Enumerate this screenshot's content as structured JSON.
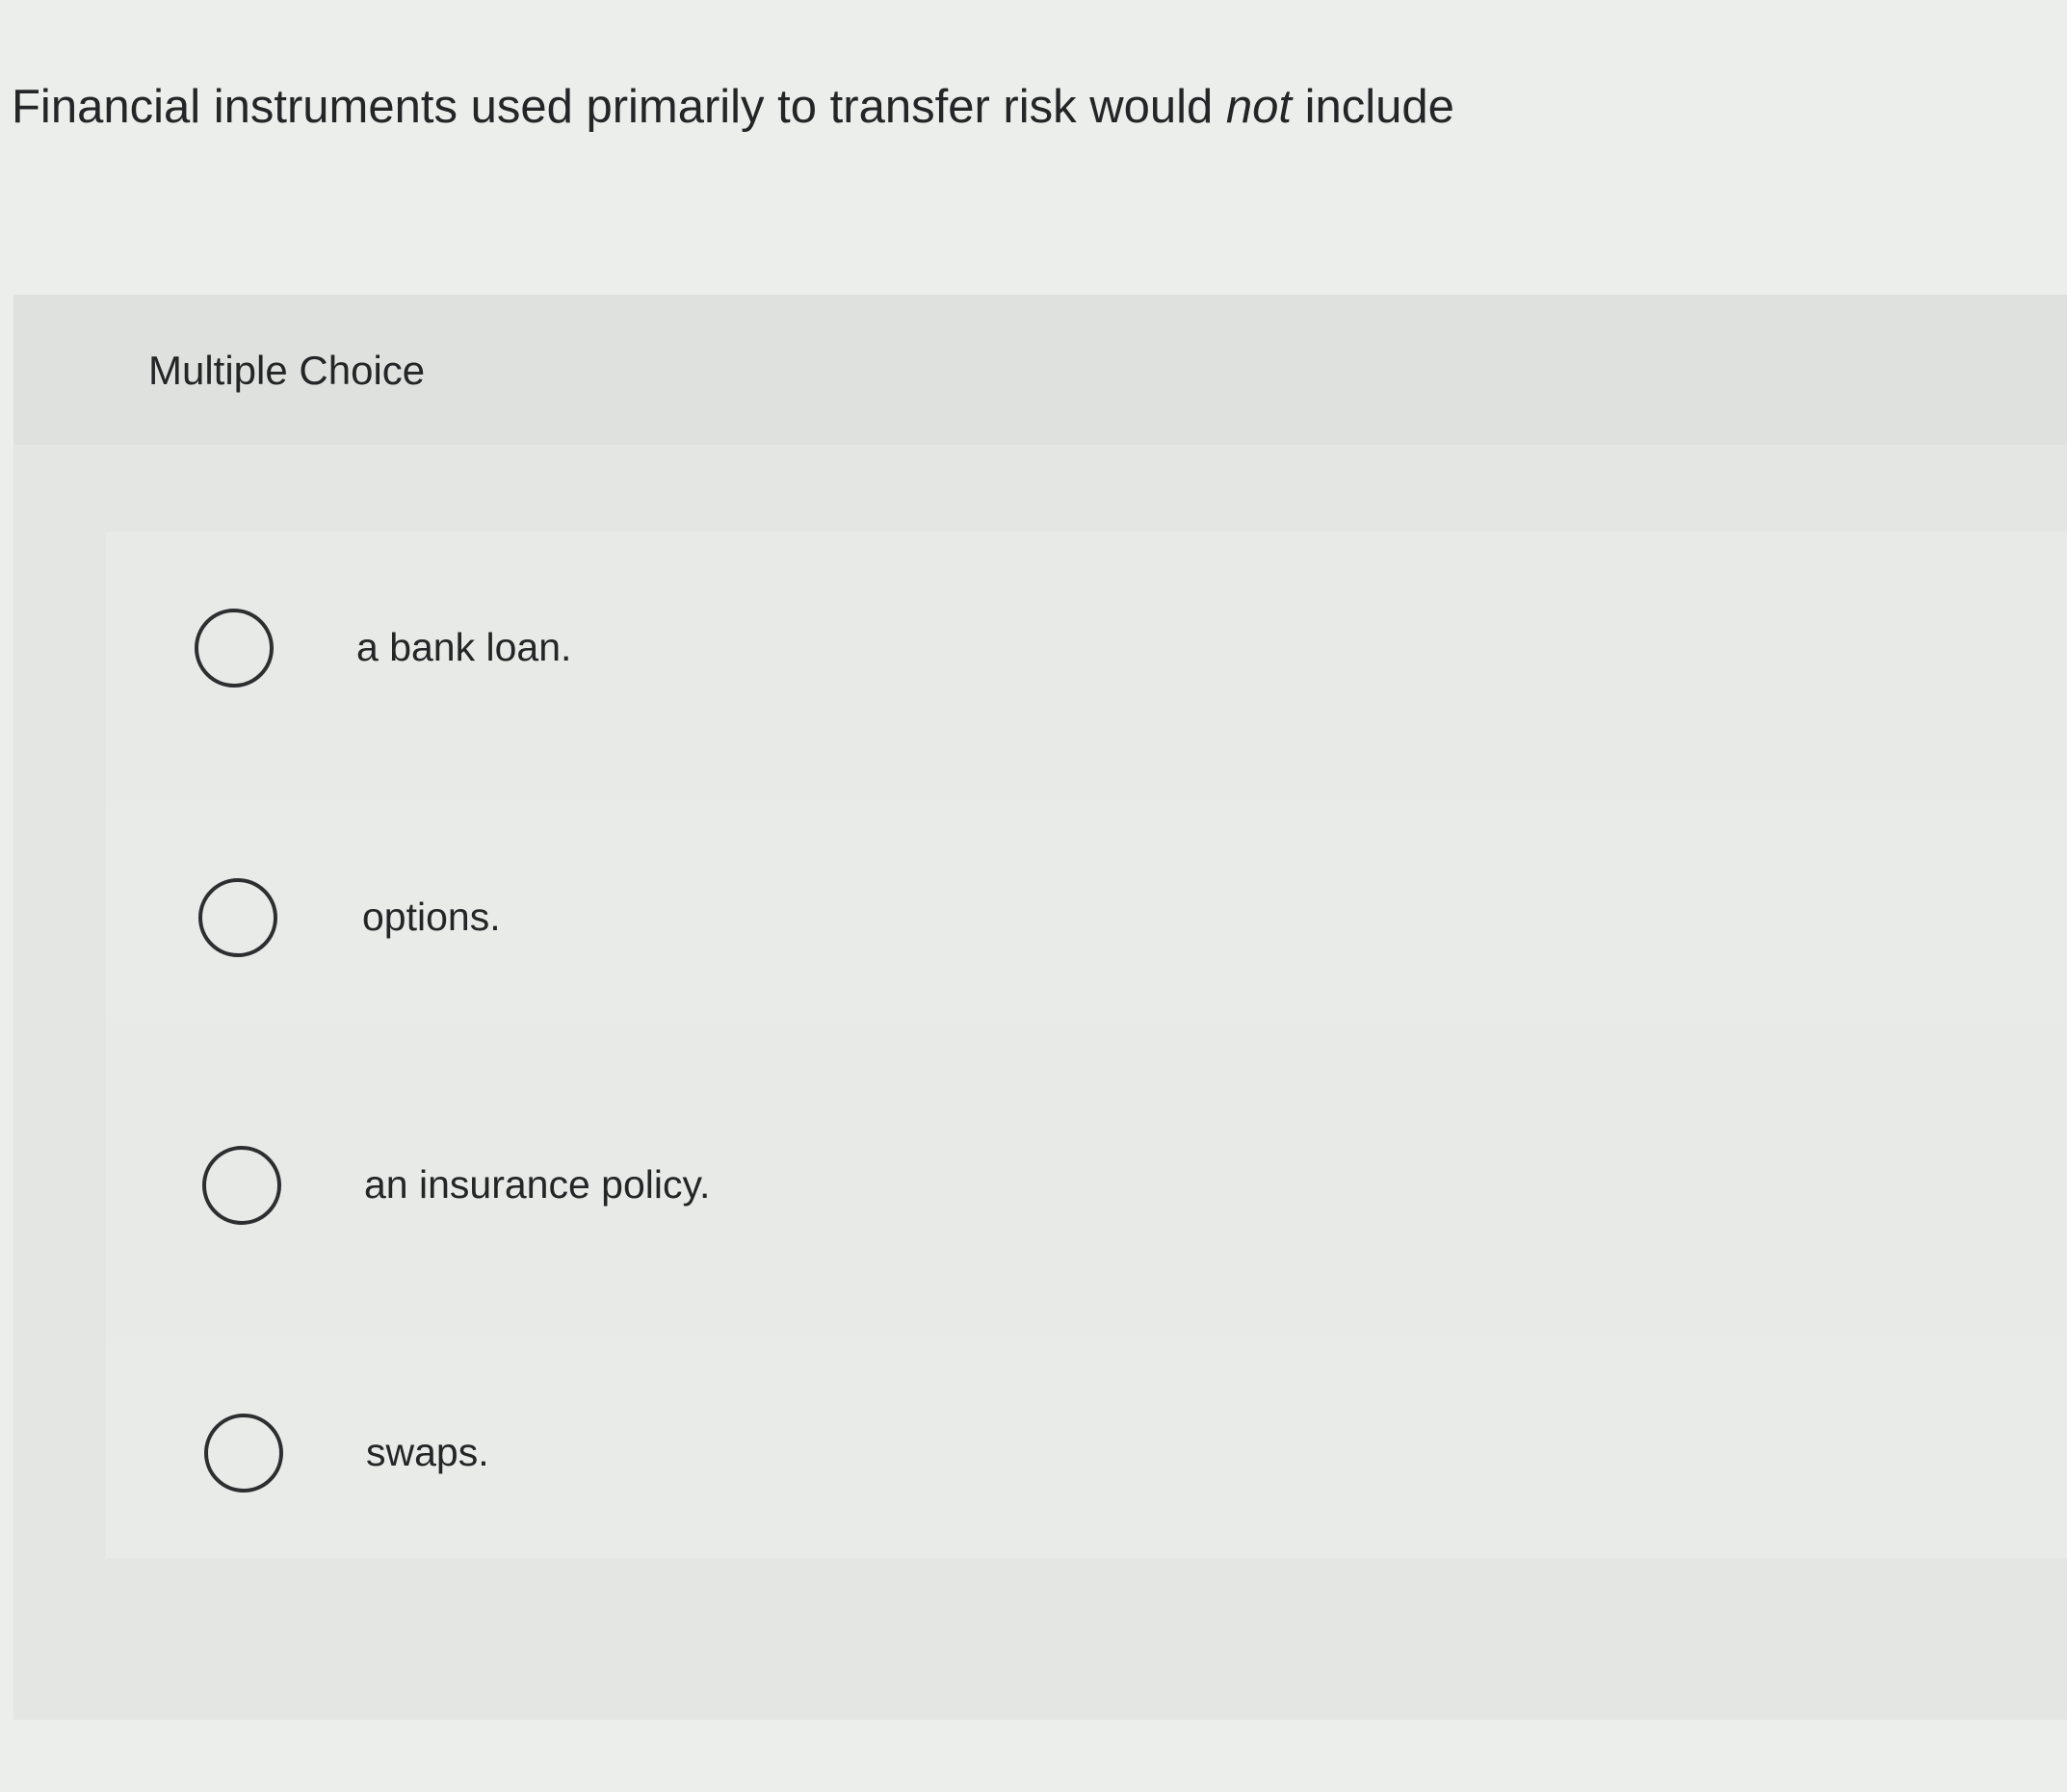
{
  "question": {
    "prefix": "Financial instruments used primarily to transfer risk would ",
    "emphasis": "not",
    "suffix": " include"
  },
  "choice_section": {
    "title": "Multiple Choice"
  },
  "options": [
    {
      "label": "a bank loan.",
      "selected": false
    },
    {
      "label": "options.",
      "selected": false
    },
    {
      "label": "an insurance policy.",
      "selected": false
    },
    {
      "label": "swaps.",
      "selected": false
    }
  ]
}
